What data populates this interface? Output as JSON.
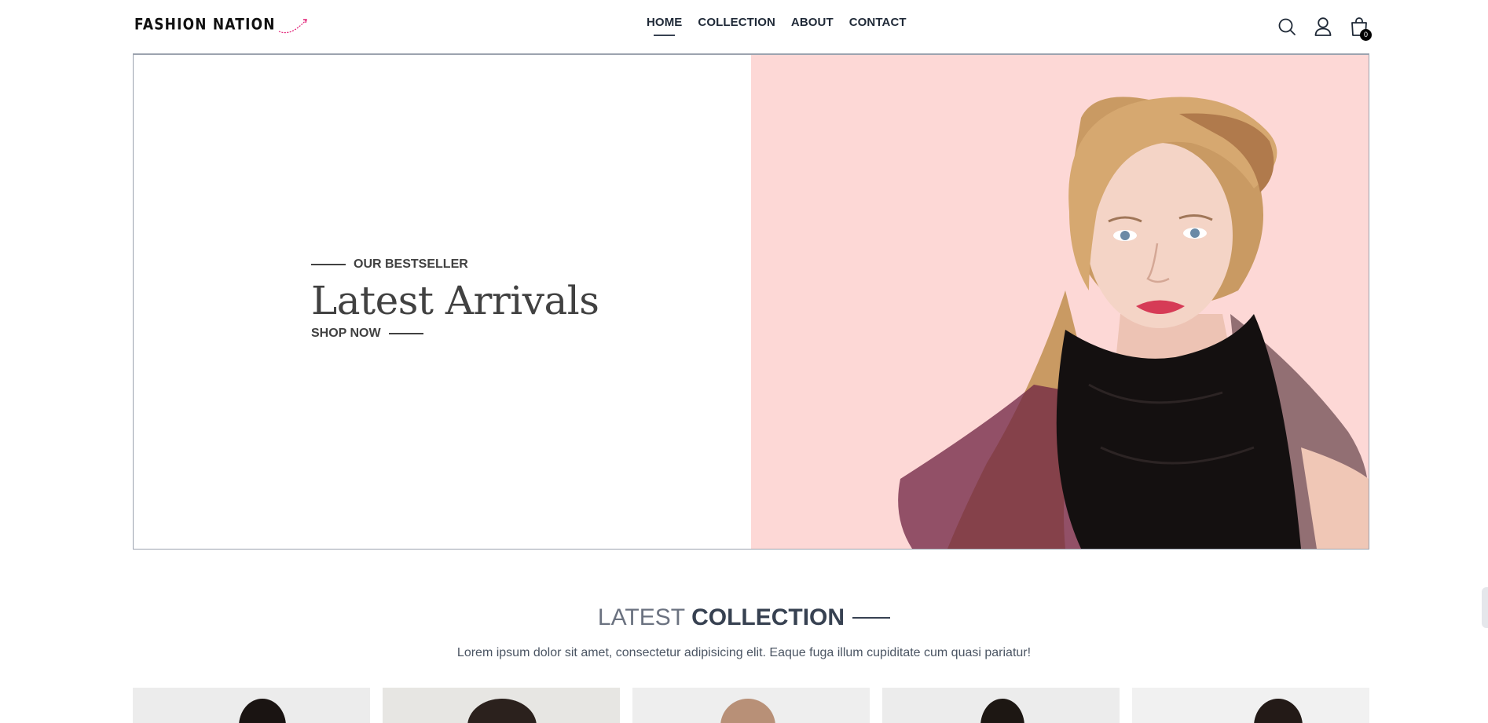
{
  "header": {
    "logo_text": "FASHION NATION",
    "nav": [
      {
        "label": "HOME",
        "active": true
      },
      {
        "label": "COLLECTION",
        "active": false
      },
      {
        "label": "ABOUT",
        "active": false
      },
      {
        "label": "CONTACT",
        "active": false
      }
    ],
    "icons": [
      "search-icon",
      "profile-icon",
      "cart-icon"
    ],
    "cart_count": "0"
  },
  "hero": {
    "eyebrow": "OUR BESTSELLER",
    "title": "Latest Arrivals",
    "cta": "SHOP NOW",
    "right_bg": "#fdd8d6"
  },
  "collection": {
    "title_light": "LATEST",
    "title_bold": "COLLECTION",
    "subtitle": "Lorem ipsum dolor sit amet, consectetur adipisicing elit. Eaque fuga illum cupiditate cum quasi pariatur!"
  },
  "colors": {
    "text_dark": "#414141",
    "border": "#9ca3af",
    "accent_pink": "#e11d74"
  }
}
